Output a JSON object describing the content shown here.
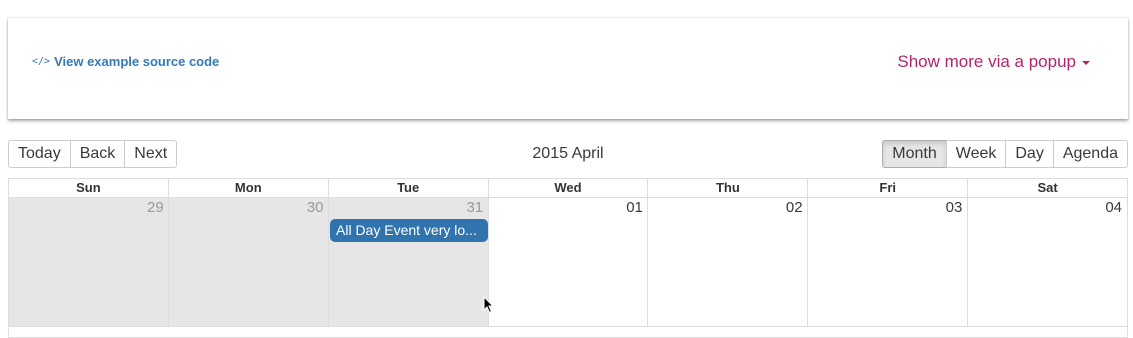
{
  "example": {
    "source_link": "View example source code",
    "source_icon": "</>",
    "popup_toggle": "Show more via a popup"
  },
  "toolbar": {
    "left_buttons": [
      "Today",
      "Back",
      "Next"
    ],
    "label": "2015 April",
    "views": [
      "Month",
      "Week",
      "Day",
      "Agenda"
    ],
    "active_view": "Month"
  },
  "calendar": {
    "weekdays": [
      "Sun",
      "Mon",
      "Tue",
      "Wed",
      "Thu",
      "Fri",
      "Sat"
    ],
    "week1": {
      "dates": [
        "29",
        "30",
        "31",
        "01",
        "02",
        "03",
        "04"
      ],
      "off_range": [
        true,
        true,
        true,
        false,
        false,
        false,
        false
      ]
    },
    "event": {
      "title": "All Day Event very lo...",
      "color": "#3174ad"
    }
  },
  "colors": {
    "link": "#337ab7",
    "popup": "#b0266e",
    "off_range_bg": "#e6e6e6"
  }
}
